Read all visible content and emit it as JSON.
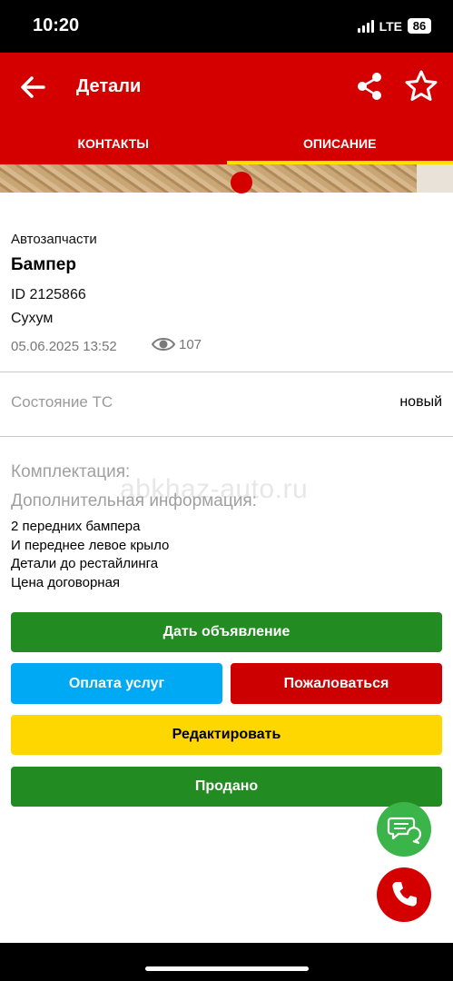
{
  "status_bar": {
    "time": "10:20",
    "network": "LTE",
    "battery": "86"
  },
  "header": {
    "title": "Детали",
    "tabs": [
      {
        "label": "КОНТАКТЫ",
        "active": false
      },
      {
        "label": "ОПИСАНИЕ",
        "active": true
      }
    ]
  },
  "listing": {
    "category": "Автозапчасти",
    "title": "Бампер",
    "id": "ID 2125866",
    "city": "Сухум",
    "date": "05.06.2025 13:52",
    "views": "107"
  },
  "condition": {
    "label": "Состояние ТС",
    "value": "новый"
  },
  "equipment_label": "Комплектация:",
  "extra_label": "Дополнительная информация:",
  "watermark": "abkhaz-auto.ru",
  "description": [
    "2 передних бампера",
    "И переднее левое крыло",
    "Детали до рестайлинга",
    "Цена договорная"
  ],
  "buttons": {
    "post_ad": "Дать объявление",
    "pay": "Оплата услуг",
    "report": "Пожаловаться",
    "edit": "Редактировать",
    "sold": "Продано"
  },
  "icons": {
    "back": "arrow-left-icon",
    "share": "share-icon",
    "favorite": "star-outline-icon",
    "views": "eye-icon",
    "chat": "chat-bubbles-icon",
    "call": "phone-icon"
  },
  "colors": {
    "primary_red": "#d40000",
    "tab_indicator": "#ffe000",
    "green": "#228b22",
    "blue": "#00a9f4",
    "yellow": "#ffd700",
    "chat_green": "#3bb54a"
  }
}
